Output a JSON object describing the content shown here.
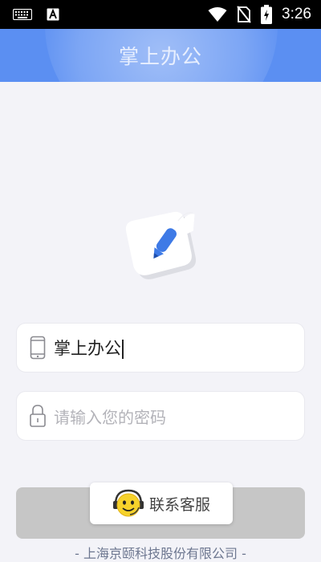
{
  "status_bar": {
    "time": "3:26",
    "icons": [
      "keyboard-icon",
      "font-a-icon",
      "wifi-icon",
      "no-sim-icon",
      "battery-charging-icon"
    ]
  },
  "header": {
    "title": "掌上办公"
  },
  "logo": {
    "icon": "hand-pen-logo-icon",
    "colors": {
      "hand": "#ffffff",
      "pen": "#3e7ae6"
    }
  },
  "account_field": {
    "icon": "phone-icon",
    "value": "掌上办公"
  },
  "password_field": {
    "icon": "lock-icon",
    "placeholder": "请输入您的密码"
  },
  "login_button": {
    "label": ""
  },
  "customer_service": {
    "icon": "smiley-headset-icon",
    "label": "联系客服"
  },
  "footer": {
    "text": "- 上海京颐科技股份有限公司 -"
  },
  "colors": {
    "header": "#5b8ff2",
    "background": "#f3f3f8",
    "button": "#c6c6c6",
    "footer_text": "#6d7790"
  }
}
